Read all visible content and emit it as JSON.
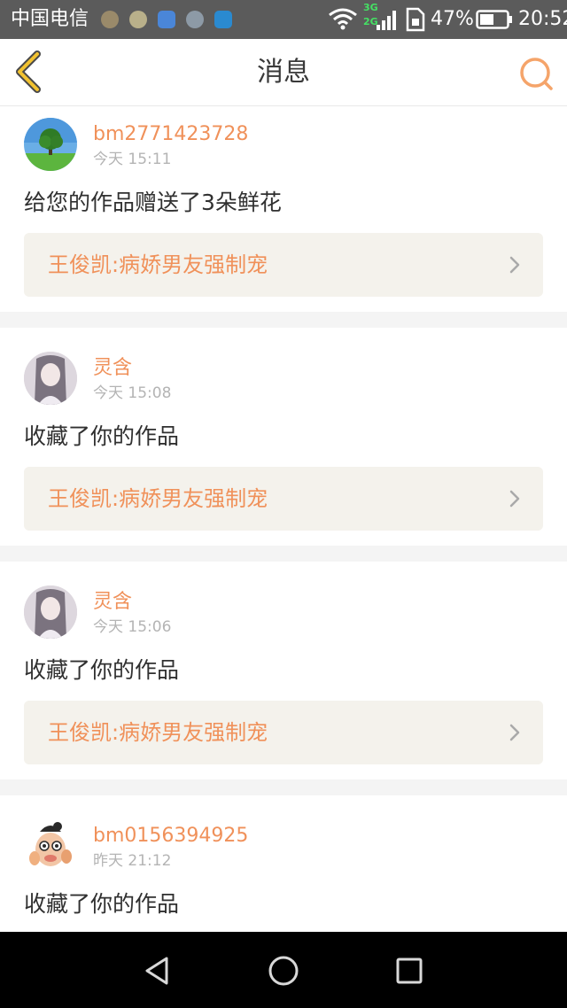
{
  "status_bar": {
    "carrier": "中国电信",
    "net_top": "3G",
    "net_bottom": "2G",
    "battery_percent": "47%",
    "time": "20:52"
  },
  "header": {
    "title": "消息",
    "back_icon": "chevron-left-icon",
    "search_icon": "search-icon"
  },
  "messages": [
    {
      "username": "bm2771423728",
      "time": "今天 15:11",
      "text": "给您的作品赠送了3朵鲜花",
      "work_title": "王俊凯:病娇男友强制宠"
    },
    {
      "username": "灵含",
      "time": "今天 15:08",
      "text": "收藏了你的作品",
      "work_title": "王俊凯:病娇男友强制宠"
    },
    {
      "username": "灵含",
      "time": "今天 15:06",
      "text": "收藏了你的作品",
      "work_title": "王俊凯:病娇男友强制宠"
    },
    {
      "username": "bm0156394925",
      "time": "昨天 21:12",
      "text": "收藏了你的作品"
    }
  ],
  "colors": {
    "accent": "#f0915a",
    "status_bar": "#5b5b5b",
    "card_link_bg": "#f4f2ec",
    "divider": "#f4f4f4"
  }
}
